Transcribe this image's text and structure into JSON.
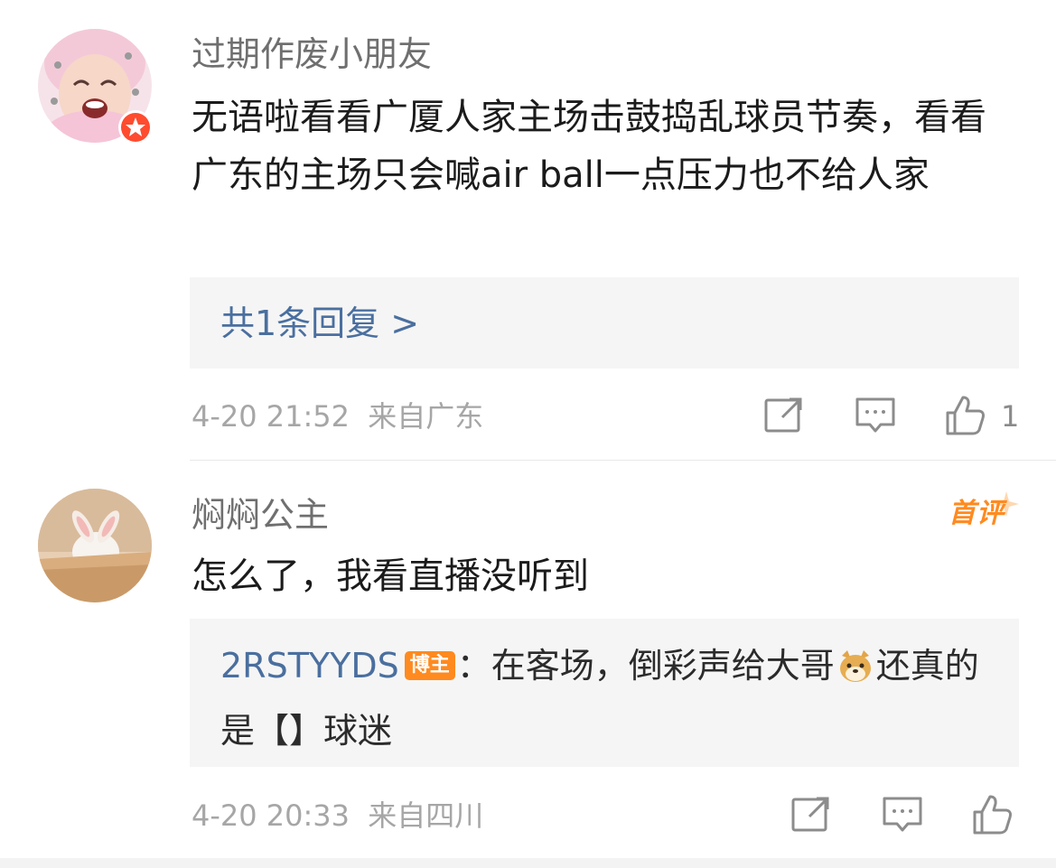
{
  "comments": [
    {
      "username": "过期作废小朋友",
      "text": "无语啦看看广厦人家主场击鼓捣乱球员节奏，看看广东的主场只会喊air ball一点压力也不给人家",
      "reply_link": "共1条回复 >",
      "timestamp": "4-20 21:52",
      "location": "来自广东",
      "like_count": "1"
    },
    {
      "username": "焖焖公主",
      "first_badge": "首评",
      "text": "怎么了，我看直播没听到",
      "reply_preview": {
        "user": "2RSTYYDS",
        "badge": "博主",
        "text_before_emoji": "：在客场，倒彩声给大哥",
        "text_after_emoji": "还真的是【】球迷"
      },
      "timestamp": "4-20 20:33",
      "location": "来自四川",
      "like_count": ""
    }
  ],
  "icons": {
    "repost": "repost-icon",
    "comment": "comment-icon",
    "like": "like-icon",
    "vip": "vip-star-icon",
    "doge": "doge-emoji-icon"
  },
  "colors": {
    "link": "#4a6f9f",
    "accent": "#ff8a1f",
    "vip_badge": "#ff4b2e",
    "meta": "#a6a6a6"
  }
}
